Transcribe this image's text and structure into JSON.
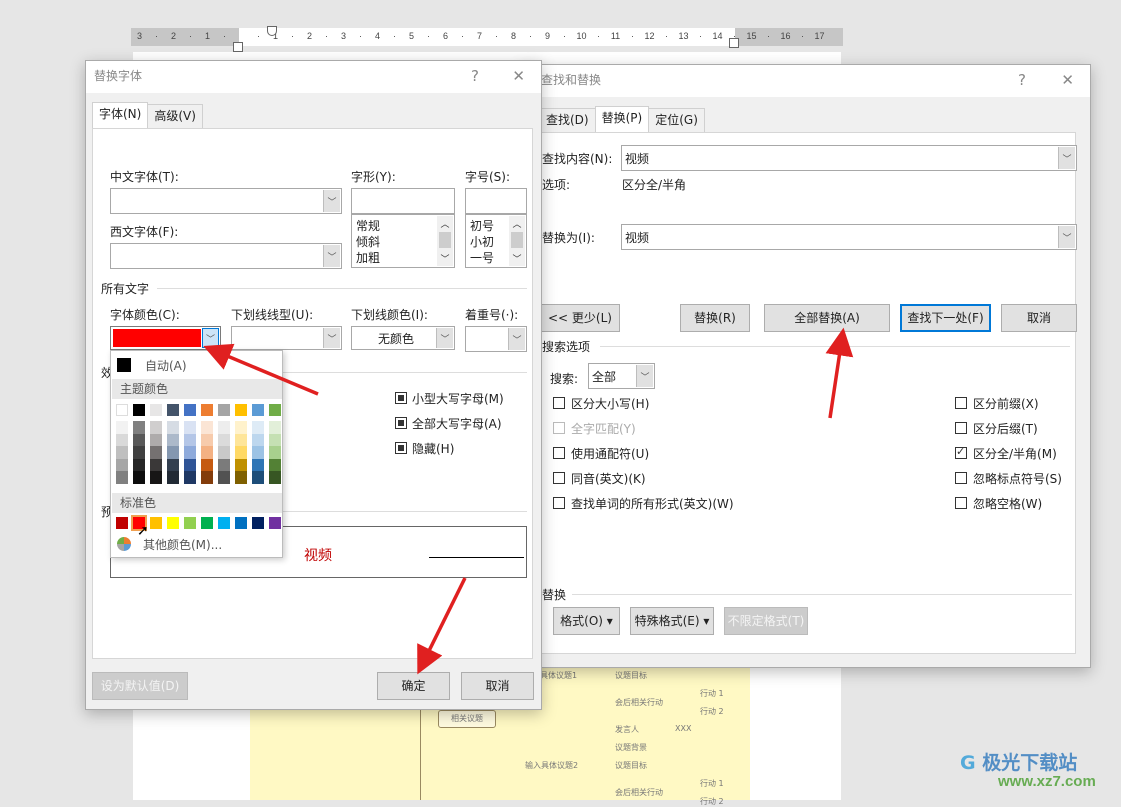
{
  "ruler": {
    "numbers": [
      "3",
      "·",
      "2",
      "·",
      "1",
      "·",
      "",
      "·",
      "1",
      "·",
      "2",
      "·",
      "3",
      "·",
      "4",
      "·",
      "5",
      "·",
      "6",
      "·",
      "7",
      "·",
      "8",
      "·",
      "9",
      "·",
      "10",
      "·",
      "11",
      "·",
      "12",
      "·",
      "13",
      "·",
      "14",
      "·",
      "15",
      "·",
      "16",
      "·",
      "17"
    ]
  },
  "mindmap": {
    "nodes": [
      "具体议题1",
      "议题目标",
      "会后相关行动",
      "行动 1",
      "行动 2",
      "相关议题",
      "发言人",
      "XXX",
      "议题背景",
      "输入具体议题2",
      "议题目标",
      "会后相关行动",
      "行动 1",
      "行动 2"
    ]
  },
  "font_dialog": {
    "title": "替换字体",
    "help": "?",
    "close": "✕",
    "tabs": [
      {
        "label": "字体(N)",
        "active": true
      },
      {
        "label": "高级(V)",
        "active": false
      }
    ],
    "chinese_font_label": "中文字体(T):",
    "chinese_font_value": "",
    "western_font_label": "西文字体(F):",
    "western_font_value": "",
    "style_label": "字形(Y):",
    "style_value": "",
    "style_options": [
      "常规",
      "倾斜",
      "加粗"
    ],
    "size_label": "字号(S):",
    "size_value": "",
    "size_options": [
      "初号",
      "小初",
      "一号"
    ],
    "all_text_section": "所有文字",
    "font_color_label": "字体颜色(C):",
    "font_color_value": "#ff0000",
    "underline_style_label": "下划线线型(U):",
    "underline_style_value": "",
    "underline_color_label": "下划线颜色(I):",
    "underline_color_value": "无颜色",
    "emphasis_label": "着重号(·):",
    "emphasis_value": "",
    "effects_section": "效",
    "effects": [
      {
        "label": "小型大写字母(M)",
        "state": "indeterminate"
      },
      {
        "label": "全部大写字母(A)",
        "state": "indeterminate"
      },
      {
        "label": "隐藏(H)",
        "state": "indeterminate"
      }
    ],
    "preview_section": "预",
    "preview_text": "视频",
    "preview_color": "#c00000",
    "set_default_button": "设为默认值(D)",
    "ok_button": "确定",
    "cancel_button": "取消"
  },
  "color_picker": {
    "auto_label": "自动(A)",
    "theme_header": "主题颜色",
    "theme_colors": [
      "#ffffff",
      "#000000",
      "#e7e6e6",
      "#44546a",
      "#4472c4",
      "#ed7d31",
      "#a5a5a5",
      "#ffc000",
      "#5b9bd5",
      "#70ad47"
    ],
    "theme_shades": [
      [
        "#f2f2f2",
        "#d9d9d9",
        "#bfbfbf",
        "#a6a6a6",
        "#808080"
      ],
      [
        "#808080",
        "#595959",
        "#404040",
        "#262626",
        "#0d0d0d"
      ],
      [
        "#d0cece",
        "#aeabab",
        "#757171",
        "#3a3838",
        "#171616"
      ],
      [
        "#d6dce4",
        "#acb9ca",
        "#8497b0",
        "#333f4f",
        "#222a35"
      ],
      [
        "#d9e2f3",
        "#b4c6e7",
        "#8eaadb",
        "#2f5496",
        "#1f3864"
      ],
      [
        "#fbe5d5",
        "#f7cbac",
        "#f4b183",
        "#c55a11",
        "#833c0b"
      ],
      [
        "#ededed",
        "#dbdbdb",
        "#c9c9c9",
        "#7b7b7b",
        "#525252"
      ],
      [
        "#fff2cc",
        "#fee599",
        "#ffd965",
        "#bf9000",
        "#7f6000"
      ],
      [
        "#deebf6",
        "#bdd7ee",
        "#9cc3e5",
        "#2e75b5",
        "#1e4e79"
      ],
      [
        "#e2efd9",
        "#c5e0b3",
        "#a8d08d",
        "#538135",
        "#375623"
      ]
    ],
    "standard_header": "标准色",
    "standard_colors": [
      "#c00000",
      "#ff0000",
      "#ffc000",
      "#ffff00",
      "#92d050",
      "#00b050",
      "#00b0f0",
      "#0070c0",
      "#002060",
      "#7030a0"
    ],
    "selected_standard_index": 1,
    "more_colors_label": "其他颜色(M)..."
  },
  "find_replace_dialog": {
    "title": "查找和替换",
    "help": "?",
    "close": "✕",
    "tabs": [
      {
        "label": "查找(D)",
        "active": false
      },
      {
        "label": "替换(P)",
        "active": true
      },
      {
        "label": "定位(G)",
        "active": false
      }
    ],
    "find_label": "查找内容(N):",
    "find_value": "视频",
    "options_label": "选项:",
    "options_value": "区分全/半角",
    "replace_label": "替换为(I):",
    "replace_value": "视频",
    "less_button": "<< 更少(L)",
    "replace_button": "替换(R)",
    "replace_all_button": "全部替换(A)",
    "find_next_button": "查找下一处(F)",
    "cancel_button": "取消",
    "search_options_section": "搜索选项",
    "search_label": "搜索:",
    "search_value": "全部",
    "left_options": [
      {
        "label": "区分大小写(H)",
        "checked": false,
        "disabled": false
      },
      {
        "label": "全字匹配(Y)",
        "checked": false,
        "disabled": true
      },
      {
        "label": "使用通配符(U)",
        "checked": false,
        "disabled": false
      },
      {
        "label": "同音(英文)(K)",
        "checked": false,
        "disabled": false
      },
      {
        "label": "查找单词的所有形式(英文)(W)",
        "checked": false,
        "disabled": false
      }
    ],
    "right_options": [
      {
        "label": "区分前缀(X)",
        "checked": false
      },
      {
        "label": "区分后缀(T)",
        "checked": false
      },
      {
        "label": "区分全/半角(M)",
        "checked": true
      },
      {
        "label": "忽略标点符号(S)",
        "checked": false
      },
      {
        "label": "忽略空格(W)",
        "checked": false
      }
    ],
    "replace_section": "替换",
    "format_button": "格式(O) ▾",
    "special_button": "特殊格式(E) ▾",
    "no_format_button": "不限定格式(T)"
  },
  "watermark": {
    "name": "极光下载站",
    "url": "www.xz7.com"
  }
}
